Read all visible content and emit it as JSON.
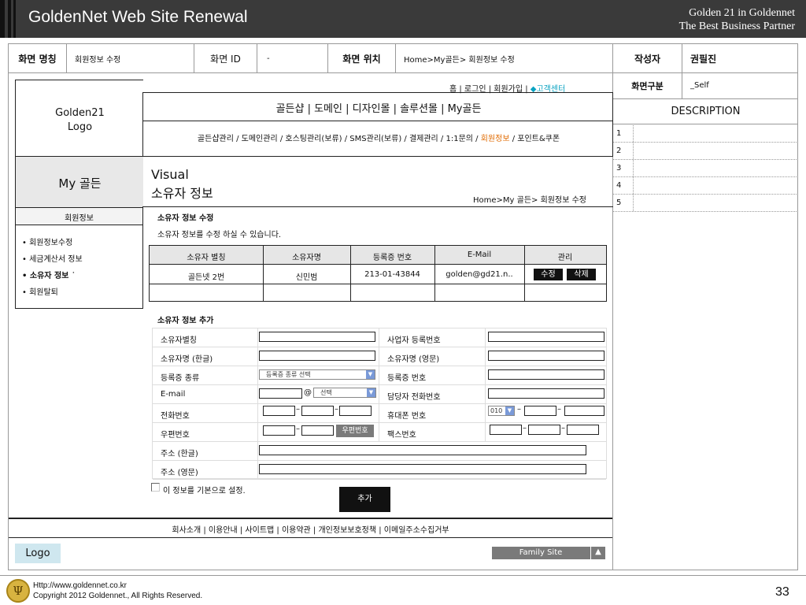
{
  "header": {
    "title": "GoldenNet Web Site Renewal",
    "tagline1": "Golden 21 in Goldennet",
    "tagline2": "The Best Business Partner"
  },
  "info": {
    "screen_name_label": "화면 명칭",
    "screen_name_value": "회원정보 수정",
    "screen_id_label": "화면 ID",
    "screen_id_value": "-",
    "screen_loc_label": "화면 위치",
    "screen_loc_value": "Home>My골든> 회원정보 수정",
    "author_label": "작성자",
    "author_value": "권필진"
  },
  "desc": {
    "type_label": "화면구분",
    "type_value": "_Self",
    "title": "DESCRIPTION",
    "rows": [
      "1",
      "2",
      "3",
      "4",
      "5"
    ]
  },
  "site": {
    "logo_text1": "Golden21",
    "logo_text2": "Logo",
    "util_links": "홈 | 로그인 | 회원가입 |",
    "util_cs": "◆고객센터",
    "gnb": "골든샵 | 도메인 | 디자인몰 | 솔루션몰 | My골든",
    "lnb_pre": "골든샵관리 / 도메인관리 / 호스팅관리(보류) / SMS관리(보류) / 결제관리 / 1:1문의 / ",
    "lnb_active": "회원정보",
    "lnb_post": " / 포인트&쿠폰",
    "side_title": "My 골든",
    "side_sub": "회원정보",
    "side_items": [
      "• 회원정보수정",
      "• 세금계산서 정보",
      "• 소유자 정보 ˙",
      "• 회원탈퇴"
    ],
    "visual1": "Visual",
    "visual2": "소유자 정보",
    "breadcrumb": "Home>My 골든> 회원정보 수정",
    "section1_title": "소유자 정보 수정",
    "section1_desc": "소유자 정보를 수정 하실 수 있습니다.",
    "table_headers": [
      "소유자 별칭",
      "소유자명",
      "등록증 번호",
      "E-Mail",
      "관리"
    ],
    "table_row": [
      "골든넷 2번",
      "신민범",
      "213-01-43844",
      "golden@gd21.n.."
    ],
    "edit_btn": "수정",
    "delete_btn": "삭제",
    "section2_title": "소유자 정보 추가",
    "form_left": [
      "소유자별칭",
      "소유자명 (한글)",
      "등록증 종류",
      "E-mail",
      "전화번호",
      "우편번호",
      "주소 (한글)",
      "주소 (영문)"
    ],
    "form_right": [
      "사업자 등록번호",
      "소유자명 (영문)",
      "등록증 번호",
      "담당자 전화번호",
      "휴대폰 번호",
      "팩스번호"
    ],
    "reg_type_select": "등록증 종류 선택",
    "email_at": "@",
    "email_select": "선택",
    "mobile_prefix": "010",
    "zip_button": "우편번호",
    "default_check": "이 정보를 기본으로 설정.",
    "add_button": "추가",
    "footer_links": "회사소개 | 이용안내 | 사이트맵 | 이용약관 | 개인정보보호정책 | 이메일주소수집거부",
    "footer_logo": "Logo",
    "family_site": "Family Site",
    "family_arrow": "▲"
  },
  "bottom": {
    "url": "Http://www.goldennet.co.kr",
    "copyright": "Copyright 2012 Goldennet., All Rights Reserved.",
    "page_num": "33"
  }
}
